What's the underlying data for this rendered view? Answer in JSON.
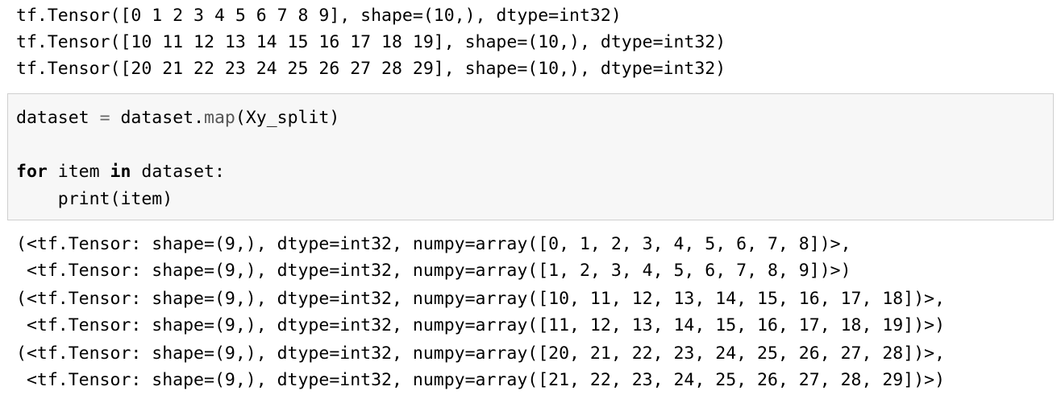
{
  "output_1": {
    "lines": [
      "tf.Tensor([0 1 2 3 4 5 6 7 8 9], shape=(10,), dtype=int32)",
      "tf.Tensor([10 11 12 13 14 15 16 17 18 19], shape=(10,), dtype=int32)",
      "tf.Tensor([20 21 22 23 24 25 26 27 28 29], shape=(10,), dtype=int32)"
    ]
  },
  "input_cell": {
    "line1": {
      "var": "dataset",
      "op": "=",
      "obj": "dataset.",
      "method": "map",
      "args": "(Xy_split)"
    },
    "line3": {
      "kw_for": "for",
      "var": "item",
      "kw_in": "in",
      "iter": "dataset:"
    },
    "line4": "    print(item)"
  },
  "output_2": {
    "lines": [
      "(<tf.Tensor: shape=(9,), dtype=int32, numpy=array([0, 1, 2, 3, 4, 5, 6, 7, 8])>,",
      " <tf.Tensor: shape=(9,), dtype=int32, numpy=array([1, 2, 3, 4, 5, 6, 7, 8, 9])>)"
    ]
  },
  "output_3": {
    "lines": [
      "(<tf.Tensor: shape=(9,), dtype=int32, numpy=array([10, 11, 12, 13, 14, 15, 16, 17, 18])>,",
      " <tf.Tensor: shape=(9,), dtype=int32, numpy=array([11, 12, 13, 14, 15, 16, 17, 18, 19])>)"
    ]
  },
  "output_4": {
    "lines": [
      "(<tf.Tensor: shape=(9,), dtype=int32, numpy=array([20, 21, 22, 23, 24, 25, 26, 27, 28])>,",
      " <tf.Tensor: shape=(9,), dtype=int32, numpy=array([21, 22, 23, 24, 25, 26, 27, 28, 29])>)"
    ]
  }
}
